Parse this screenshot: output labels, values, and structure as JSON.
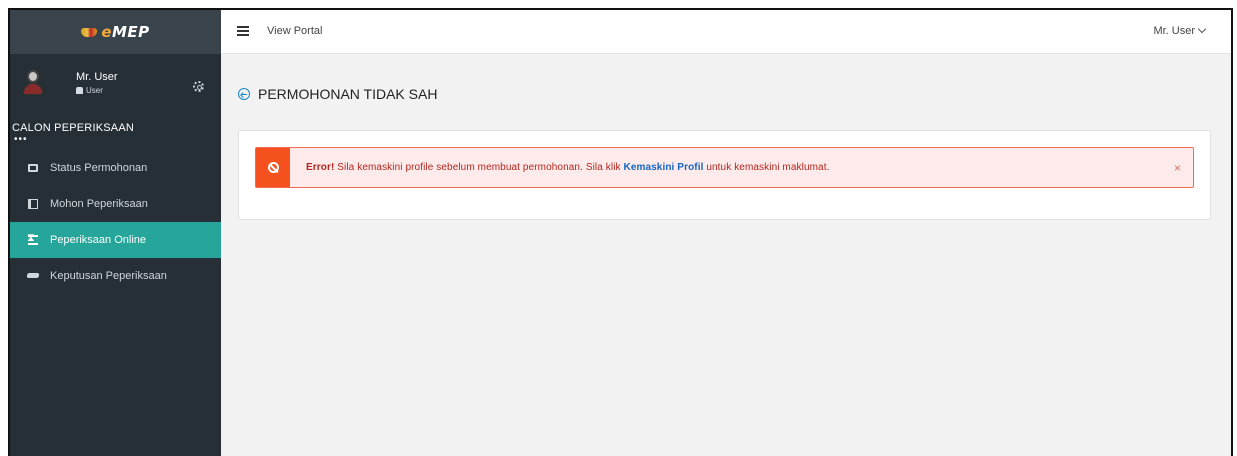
{
  "brand": {
    "prefix": "e",
    "name": "MEP"
  },
  "profile": {
    "name": "Mr. User",
    "role": "User"
  },
  "sidebar": {
    "section_title": "CALON PEPERIKSAAN",
    "section_dots": "•••",
    "items": [
      {
        "label": "Status Permohonan",
        "icon": "printer-icon"
      },
      {
        "label": "Mohon Peperiksaan",
        "icon": "book-icon"
      },
      {
        "label": "Peperiksaan Online",
        "icon": "hourglass-icon",
        "active": true
      },
      {
        "label": "Keputusan Peperiksaan",
        "icon": "graduation-cap-icon"
      }
    ]
  },
  "header": {
    "view_portal": "View Portal",
    "user_menu": "Mr. User"
  },
  "main": {
    "title": "PERMOHONAN TIDAK SAH",
    "alert": {
      "strong": "Error!",
      "text_before": " Sila kemaskini profile sebelum membuat permohonan. Sila klik ",
      "link": "Kemaskini Profil",
      "text_after": " untuk kemaskini maklumat.",
      "close": "×"
    }
  },
  "colors": {
    "sidebar": "#262e36",
    "active": "#26a69a",
    "alert_bg": "#fcebea",
    "alert_accent": "#f4511e"
  }
}
